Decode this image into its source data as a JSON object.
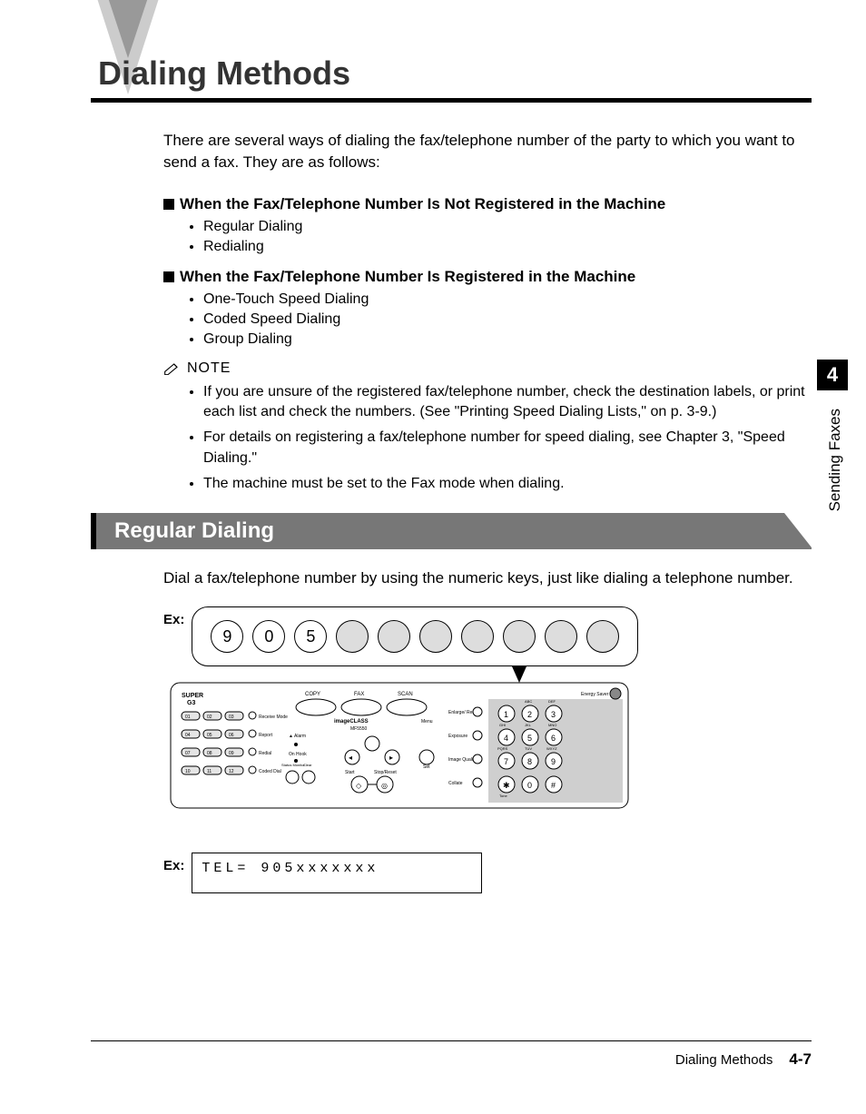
{
  "title": "Dialing Methods",
  "intro": "There are several ways of dialing the fax/telephone number of the party to which you want to send a fax. They are as follows:",
  "sections": [
    {
      "heading": "When the Fax/Telephone Number Is Not Registered in the Machine",
      "items": [
        "Regular Dialing",
        "Redialing"
      ]
    },
    {
      "heading": "When the Fax/Telephone Number Is Registered in the Machine",
      "items": [
        "One-Touch Speed Dialing",
        "Coded Speed Dialing",
        "Group Dialing"
      ]
    }
  ],
  "note_label": "NOTE",
  "notes": [
    "If you are unsure of the registered fax/telephone number, check the destination labels, or print each list and check the numbers. (See \"Printing Speed Dialing Lists,\" on p. 3-9.)",
    "For details on registering a fax/telephone number for speed dialing, see Chapter 3, \"Speed Dialing.\"",
    "The machine must be set to the Fax mode when dialing."
  ],
  "subsection": "Regular Dialing",
  "subsection_body": "Dial a fax/telephone number by using the numeric keys, just like dialing a telephone number.",
  "ex_label": "Ex:",
  "keypad_digits": [
    "9",
    "0",
    "5",
    "",
    "",
    "",
    "",
    "",
    "",
    ""
  ],
  "panel_labels": {
    "copy": "COPY",
    "fax": "FAX",
    "scan": "SCAN",
    "menu": "Menu",
    "set": "Set",
    "start": "Start",
    "stopreset": "Stop/Reset",
    "enlarge": "Enlarge/\nReduce",
    "exposure": "Exposure",
    "image_quality": "Image\nQuality",
    "collate": "Collate",
    "super": "SUPER",
    "g3": "G3",
    "imageclass": "imageCLASS",
    "model": "MF5550",
    "energy": "Energy Saver",
    "abc": "ABC",
    "def": "DEF",
    "ghi": "GHI",
    "jkl": "JKL",
    "mno": "MNO",
    "pqrs": "PQRS",
    "tuv": "TUV",
    "wxyz": "WXYZ",
    "tone": "Tone",
    "receive": "Receive\nMode",
    "report": "Report",
    "redial": "Redial",
    "coded": "Coded\nDial",
    "alarm": "Alarm",
    "onhook": "On Hook",
    "status": "Status\nMonitor",
    "clear": "Clear",
    "keys_012": [
      "01",
      "02",
      "03",
      "04",
      "05",
      "06",
      "07",
      "08",
      "09",
      "10",
      "11",
      "12"
    ]
  },
  "lcd_text": "TEL=       905xxxxxxx",
  "side_chapter": "4",
  "side_text": "Sending Faxes",
  "footer_title": "Dialing Methods",
  "footer_page": "4-7"
}
